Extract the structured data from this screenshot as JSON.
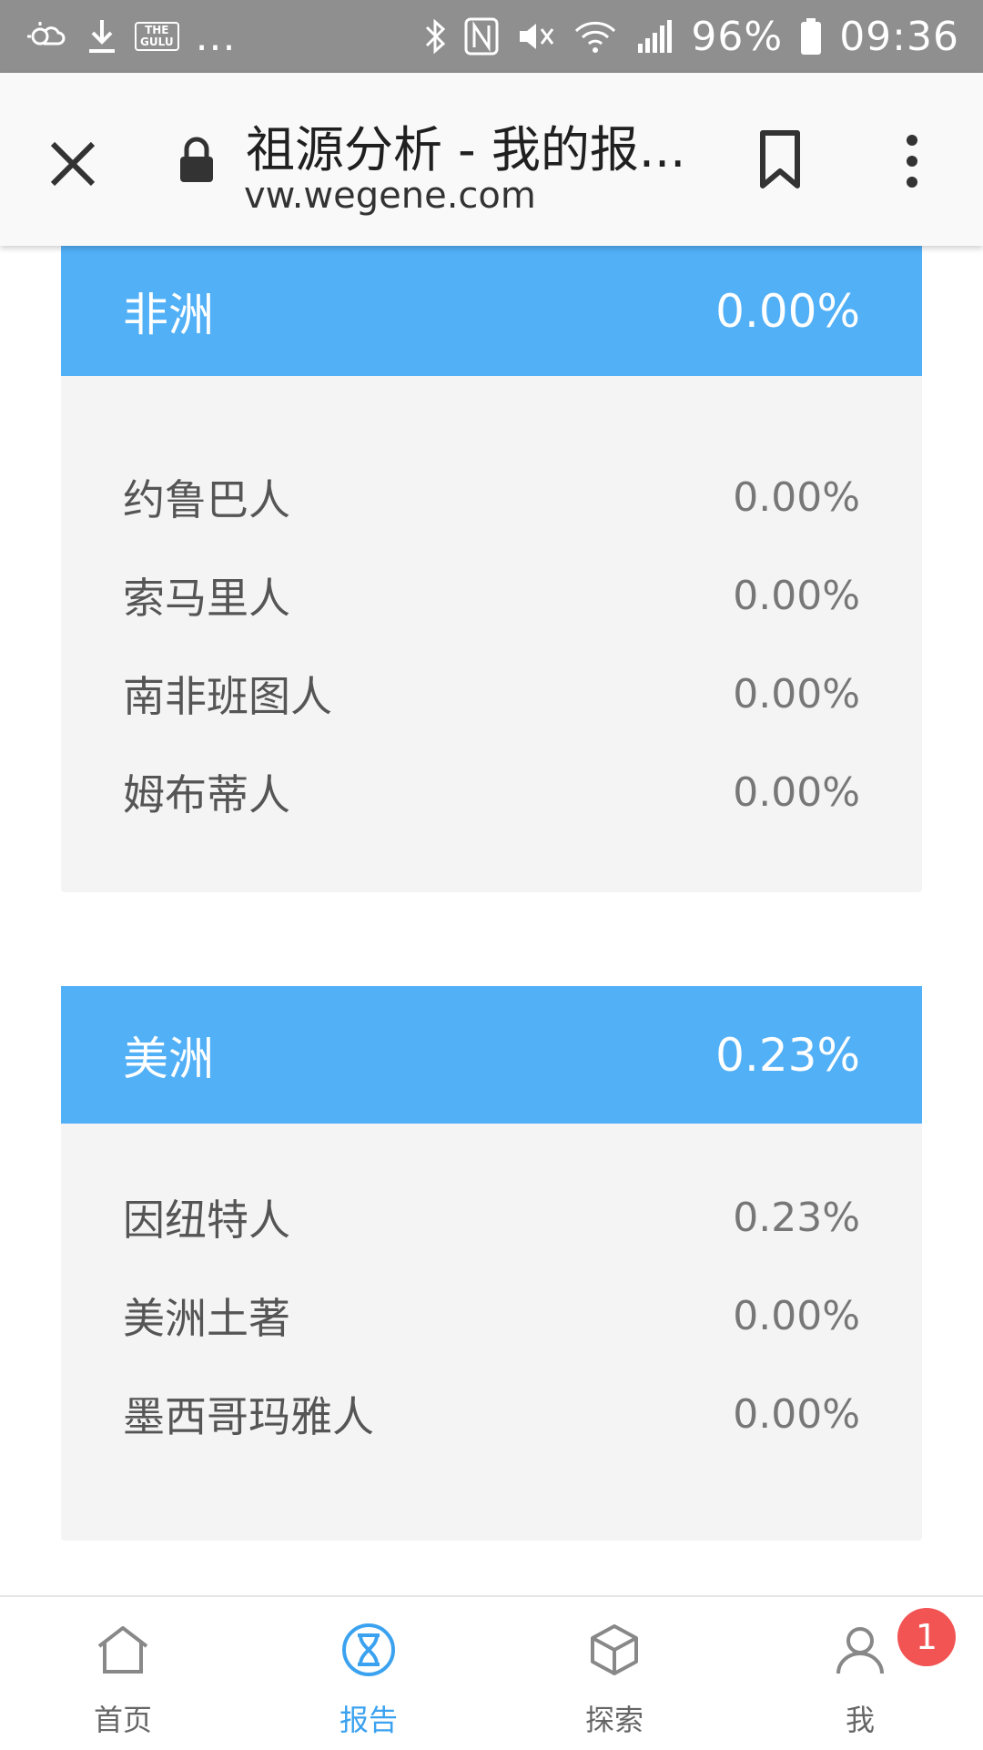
{
  "status_bar": {
    "app_label": "THE\nGULU",
    "ellipsis": "...",
    "battery": "96%",
    "time": "09:36"
  },
  "browser": {
    "title": "祖源分析 - 我的报...",
    "url": "vw.wegene.com"
  },
  "regions": [
    {
      "name": "非洲",
      "percent": "0.00%",
      "items": [
        {
          "name": "约鲁巴人",
          "percent": "0.00%"
        },
        {
          "name": "索马里人",
          "percent": "0.00%"
        },
        {
          "name": "南非班图人",
          "percent": "0.00%"
        },
        {
          "name": "姆布蒂人",
          "percent": "0.00%"
        }
      ]
    },
    {
      "name": "美洲",
      "percent": "0.23%",
      "items": [
        {
          "name": "因纽特人",
          "percent": "0.23%"
        },
        {
          "name": "美洲土著",
          "percent": "0.00%"
        },
        {
          "name": "墨西哥玛雅人",
          "percent": "0.00%"
        }
      ]
    }
  ],
  "bottom_nav": {
    "items": [
      {
        "label": "首页",
        "icon": "home-icon"
      },
      {
        "label": "报告",
        "icon": "dna-icon",
        "active": true
      },
      {
        "label": "探索",
        "icon": "cube-icon"
      },
      {
        "label": "我",
        "icon": "user-icon",
        "badge": "1"
      }
    ]
  },
  "colors": {
    "header_blue": "#52b0f7",
    "active_blue": "#3ba2f0",
    "badge_red": "#f25454",
    "card_bg": "#f4f4f4"
  }
}
